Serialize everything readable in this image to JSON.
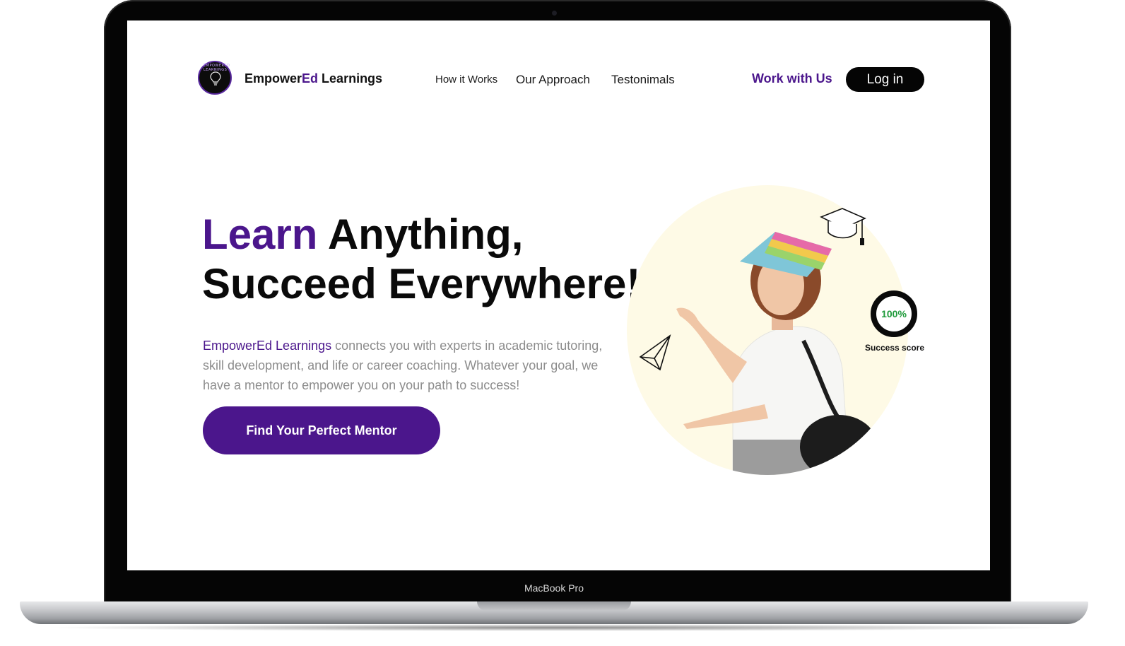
{
  "device": {
    "model_label": "MacBook Pro"
  },
  "nav": {
    "logo_text": "EMPOWERED LEARNINGS",
    "brand_main": "Empower",
    "brand_accent": "Ed",
    "brand_tail": " Learnings",
    "links": [
      "How it Works",
      "Our Approach",
      "Testonimals"
    ],
    "work_with_us": "Work with Us",
    "login": "Log in"
  },
  "hero": {
    "headline_accent": "Learn",
    "headline_rest": " Anything,",
    "headline_line2": "Succeed Everywhere!",
    "lead_brand": "EmpowerEd Learnings",
    "lead_text": " connects you with experts in academic tutoring, skill development, and life or career coaching. Whatever your goal, we have a mentor to empower you on your path to success!",
    "cta": "Find Your Perfect Mentor"
  },
  "score": {
    "value": "100%",
    "label": "Success score"
  },
  "colors": {
    "brand_purple": "#4b168c",
    "score_green": "#1e9a3a",
    "hero_circle": "#fefae6"
  },
  "icons": [
    "logo-bulb-icon",
    "graduation-cap-icon",
    "paper-plane-icon"
  ]
}
